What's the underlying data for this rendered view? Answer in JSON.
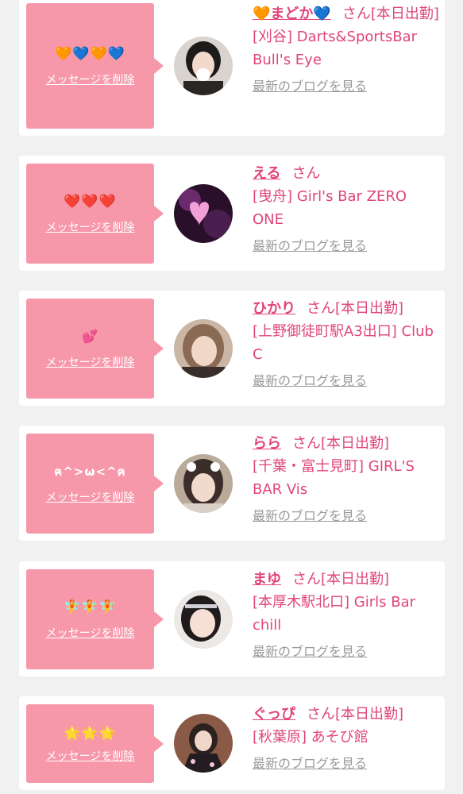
{
  "entries": [
    {
      "message": "🧡💙🧡💙",
      "delete_label": "メッセージを削除",
      "name": "🧡まどか💙",
      "honorific": "さん",
      "status": "[本日出勤]",
      "shop": "[刈谷] Darts&SportsBar Bull's Eye",
      "blog_label": "最新のブログを見る"
    },
    {
      "message": "❤️❤️❤️",
      "delete_label": "メッセージを削除",
      "name": "える",
      "honorific": "さん",
      "status": "",
      "shop": "[曳舟] Girl's Bar ZERO ONE",
      "blog_label": "最新のブログを見る"
    },
    {
      "message": "💕",
      "delete_label": "メッセージを削除",
      "name": "ひかり",
      "honorific": "さん",
      "status": "[本日出勤]",
      "shop": "[上野御徒町駅A3出口] Club C",
      "blog_label": "最新のブログを見る"
    },
    {
      "message": "ฅ^>ω<^ฅ",
      "delete_label": "メッセージを削除",
      "name": "らら",
      "honorific": "さん",
      "status": "[本日出勤]",
      "shop": "[千葉・富士見町] GIRL'S BAR Vis",
      "blog_label": "最新のブログを見る"
    },
    {
      "message": "🧚🧚🧚",
      "delete_label": "メッセージを削除",
      "name": "まゆ",
      "honorific": "さん",
      "status": "[本日出勤]",
      "shop": "[本厚木駅北口] Girls Bar chill",
      "blog_label": "最新のブログを見る"
    },
    {
      "message": "🌟🌟🌟",
      "delete_label": "メッセージを削除",
      "name": "ぐっぴ",
      "honorific": "さん",
      "status": "[本日出勤]",
      "shop": "[秋葉原] あそび館",
      "blog_label": "最新のブログを見る"
    }
  ],
  "colors": {
    "accent": "#e0457a",
    "bubble": "#f798aa",
    "link_gray": "#9a9a9a",
    "background": "#f1f1f1"
  }
}
